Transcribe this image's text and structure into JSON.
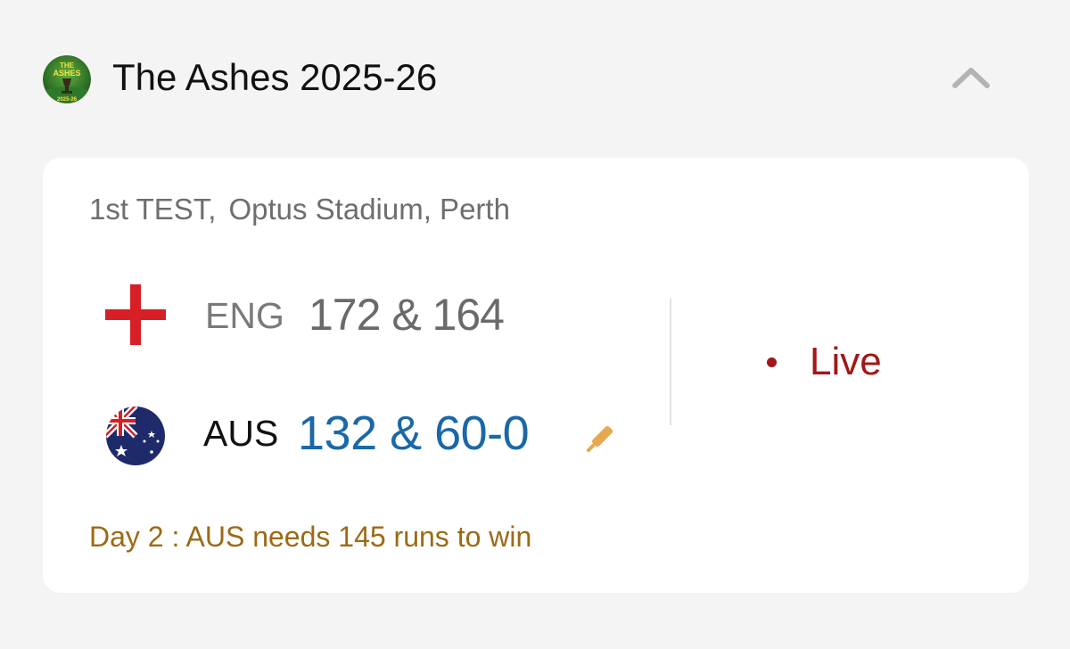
{
  "series": {
    "logo": {
      "icon": "ashes-series-logo",
      "line1": "THE",
      "line2": "ASHES",
      "line3": "2025-26"
    },
    "title": "The Ashes 2025-26",
    "collapse_icon": "chevron-up-icon"
  },
  "match": {
    "test_label": "1st TEST,",
    "venue": "Optus Stadium, Perth",
    "teams": [
      {
        "code": "ENG",
        "score": "172 & 164",
        "flag_icon": "england-flag-icon",
        "batting": false
      },
      {
        "code": "AUS",
        "score": "132 & 60-0",
        "flag_icon": "australia-flag-icon",
        "batting": true,
        "batting_icon": "cricket-bat-icon"
      }
    ],
    "live_label": "Live",
    "status_text": "Day 2 : AUS needs 145 runs to win"
  },
  "colors": {
    "background": "#f4f4f4",
    "card": "#ffffff",
    "live": "#a01818",
    "batting_score": "#1a68a8",
    "status": "#9c6a15",
    "bat": "#e5a84e"
  }
}
